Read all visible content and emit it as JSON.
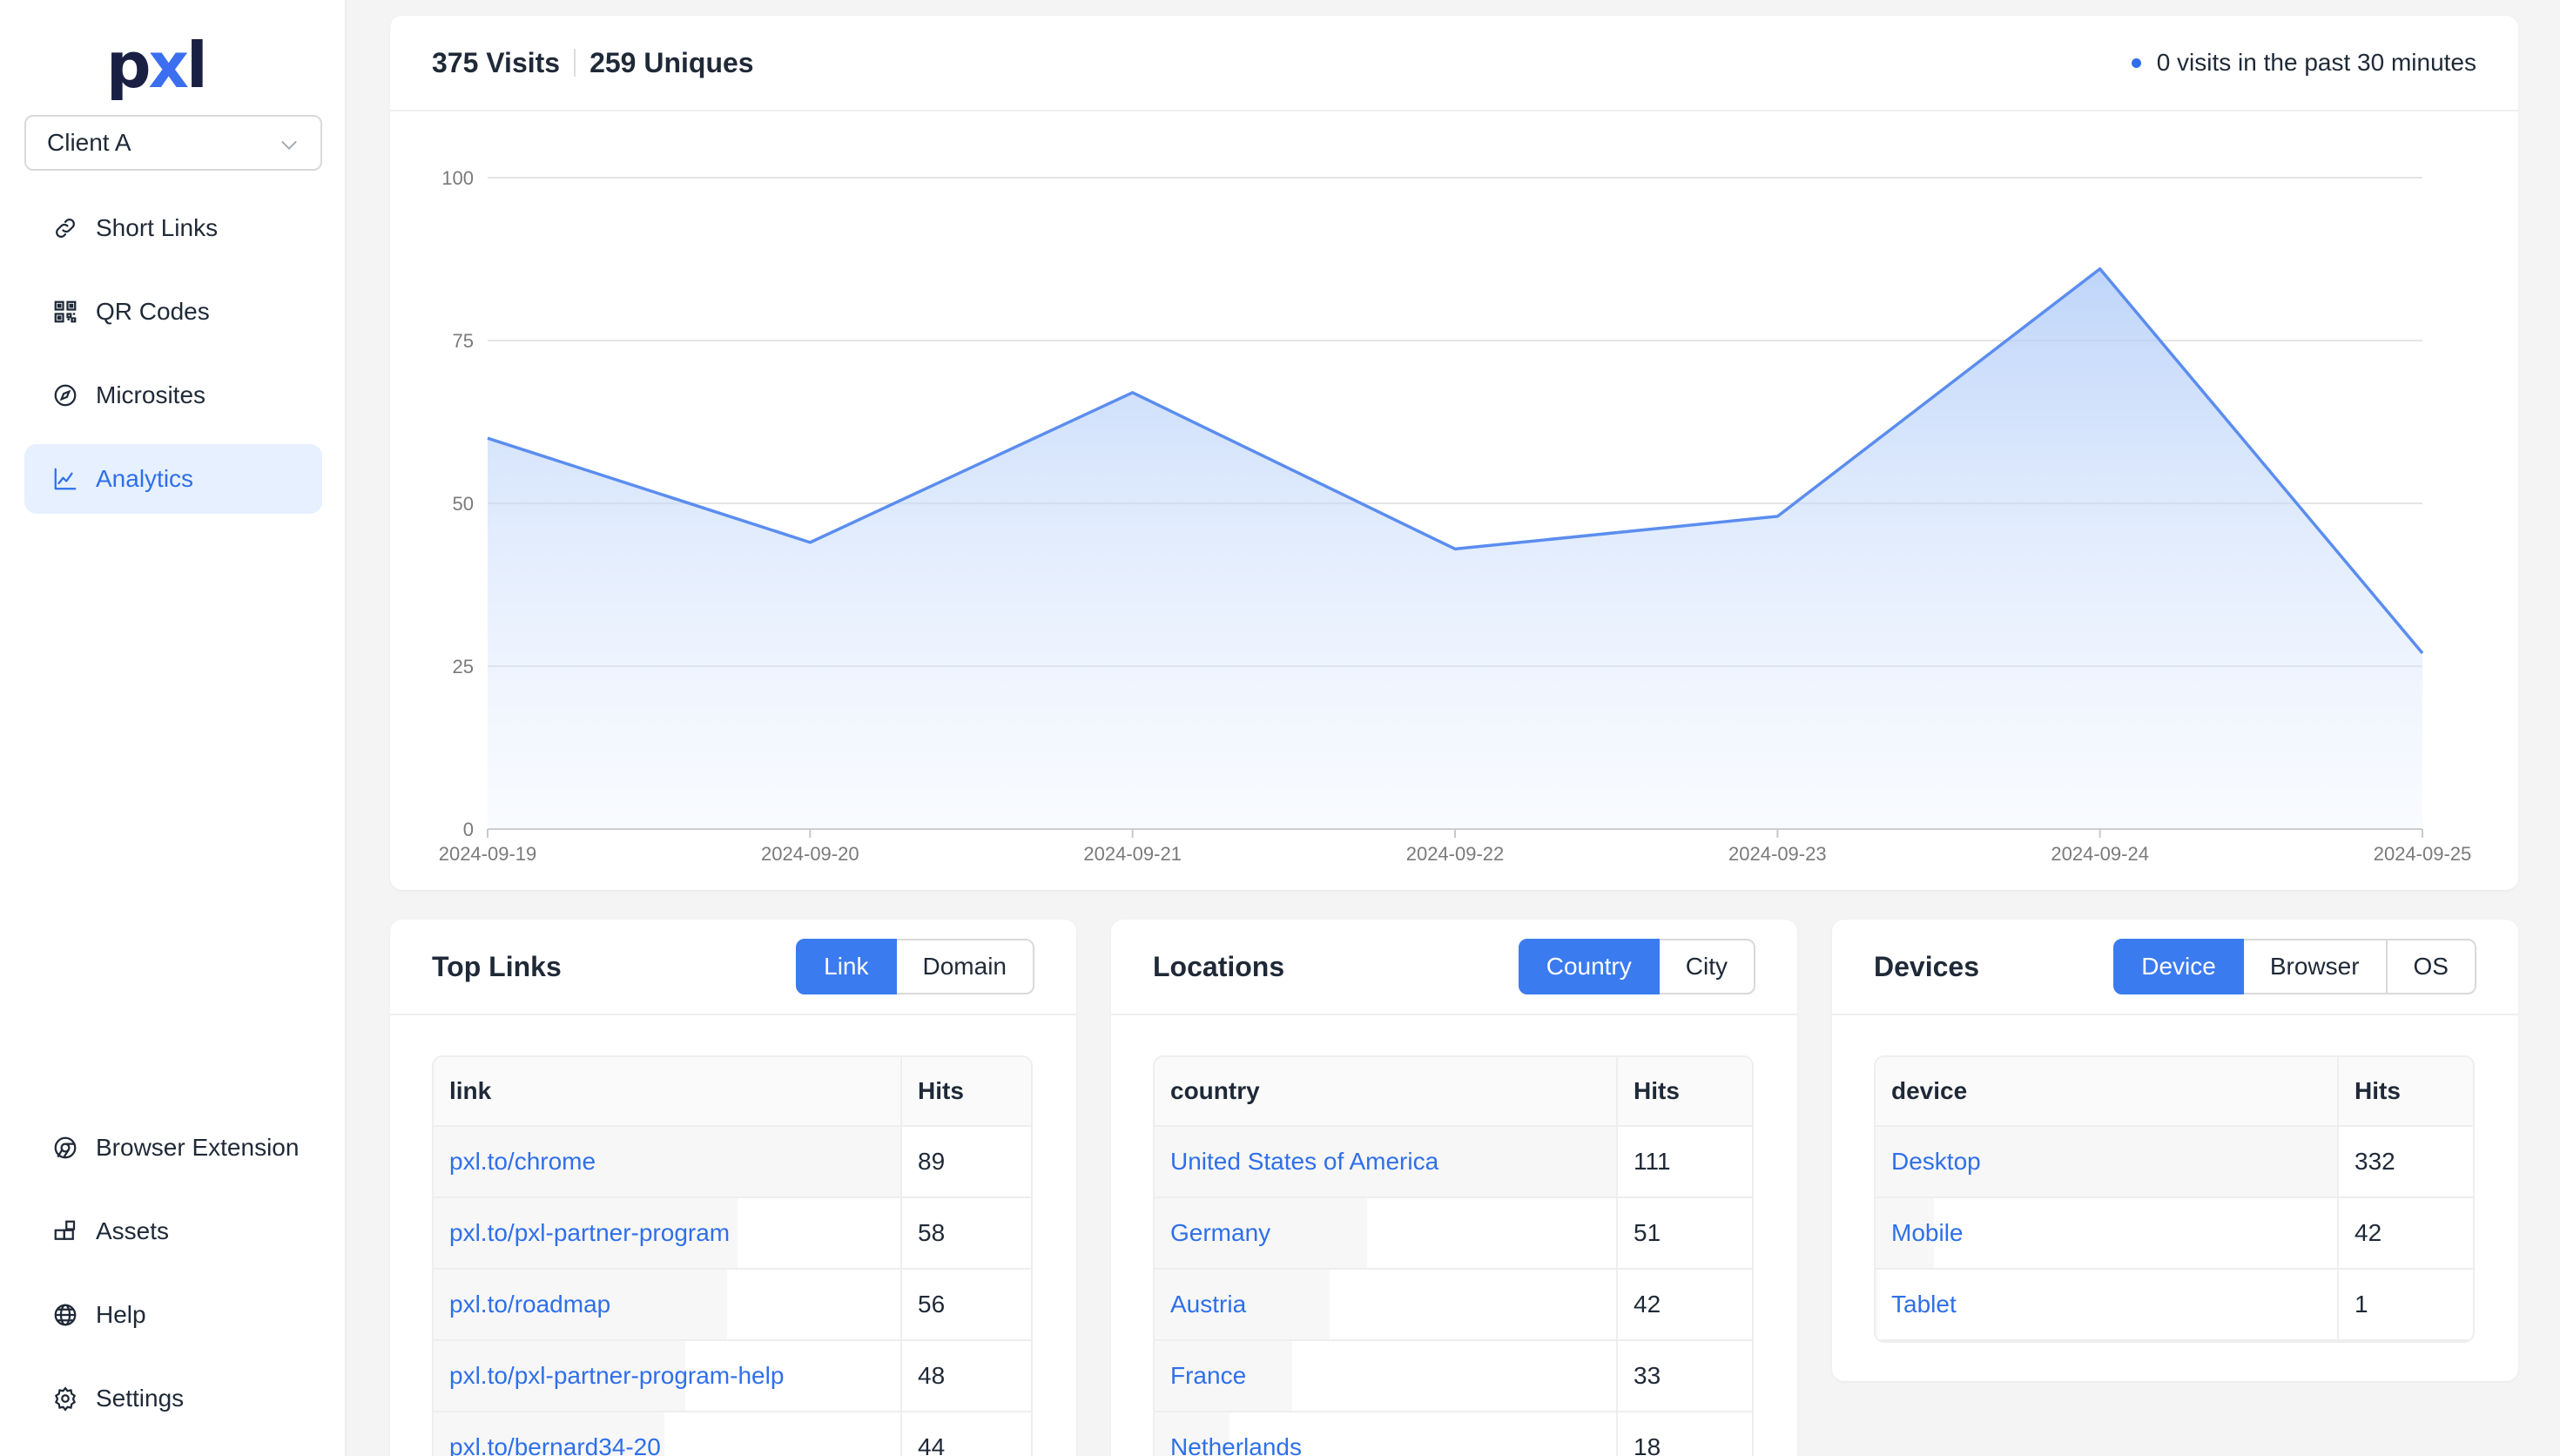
{
  "logo": {
    "pre": "p",
    "x": "x",
    "post": "l"
  },
  "client_select": {
    "value": "Client A"
  },
  "nav": {
    "top": [
      {
        "label": "Short Links",
        "icon": "link-icon"
      },
      {
        "label": "QR Codes",
        "icon": "qr-icon"
      },
      {
        "label": "Microsites",
        "icon": "compass-icon"
      },
      {
        "label": "Analytics",
        "icon": "chart-line-icon",
        "active": true
      }
    ],
    "bottom": [
      {
        "label": "Browser Extension",
        "icon": "chrome-icon"
      },
      {
        "label": "Assets",
        "icon": "blocks-icon"
      },
      {
        "label": "Help",
        "icon": "globe-icon"
      },
      {
        "label": "Settings",
        "icon": "gear-icon"
      }
    ]
  },
  "summary": {
    "visits": "375 Visits",
    "uniques": "259 Uniques",
    "live": "0 visits in the past 30 minutes"
  },
  "chart_data": {
    "type": "area",
    "x": [
      "2024-09-19",
      "2024-09-20",
      "2024-09-21",
      "2024-09-22",
      "2024-09-23",
      "2024-09-24",
      "2024-09-25"
    ],
    "series": [
      {
        "values": [
          60,
          44,
          67,
          43,
          48,
          86,
          27
        ]
      }
    ],
    "yticks": [
      "0",
      "25",
      "50",
      "75",
      "100"
    ],
    "ylim": [
      0,
      100
    ],
    "grid": true,
    "color": "#5b8def"
  },
  "top_links": {
    "title": "Top Links",
    "tabs": [
      "Link",
      "Domain"
    ],
    "active": 0,
    "columns": [
      "link",
      "Hits"
    ],
    "max": 89,
    "rows": [
      {
        "name": "pxl.to/chrome",
        "hits": 89
      },
      {
        "name": "pxl.to/pxl-partner-program",
        "hits": 58
      },
      {
        "name": "pxl.to/roadmap",
        "hits": 56
      },
      {
        "name": "pxl.to/pxl-partner-program-help",
        "hits": 48
      },
      {
        "name": "pxl.to/bernard34-20",
        "hits": 44
      }
    ]
  },
  "locations": {
    "title": "Locations",
    "tabs": [
      "Country",
      "City"
    ],
    "active": 0,
    "columns": [
      "country",
      "Hits"
    ],
    "max": 111,
    "rows": [
      {
        "name": "United States of America",
        "hits": 111
      },
      {
        "name": "Germany",
        "hits": 51
      },
      {
        "name": "Austria",
        "hits": 42
      },
      {
        "name": "France",
        "hits": 33
      },
      {
        "name": "Netherlands",
        "hits": 18
      }
    ]
  },
  "devices": {
    "title": "Devices",
    "tabs": [
      "Device",
      "Browser",
      "OS"
    ],
    "active": 0,
    "columns": [
      "device",
      "Hits"
    ],
    "max": 332,
    "rows": [
      {
        "name": "Desktop",
        "hits": 332
      },
      {
        "name": "Mobile",
        "hits": 42
      },
      {
        "name": "Tablet",
        "hits": 1
      }
    ]
  }
}
